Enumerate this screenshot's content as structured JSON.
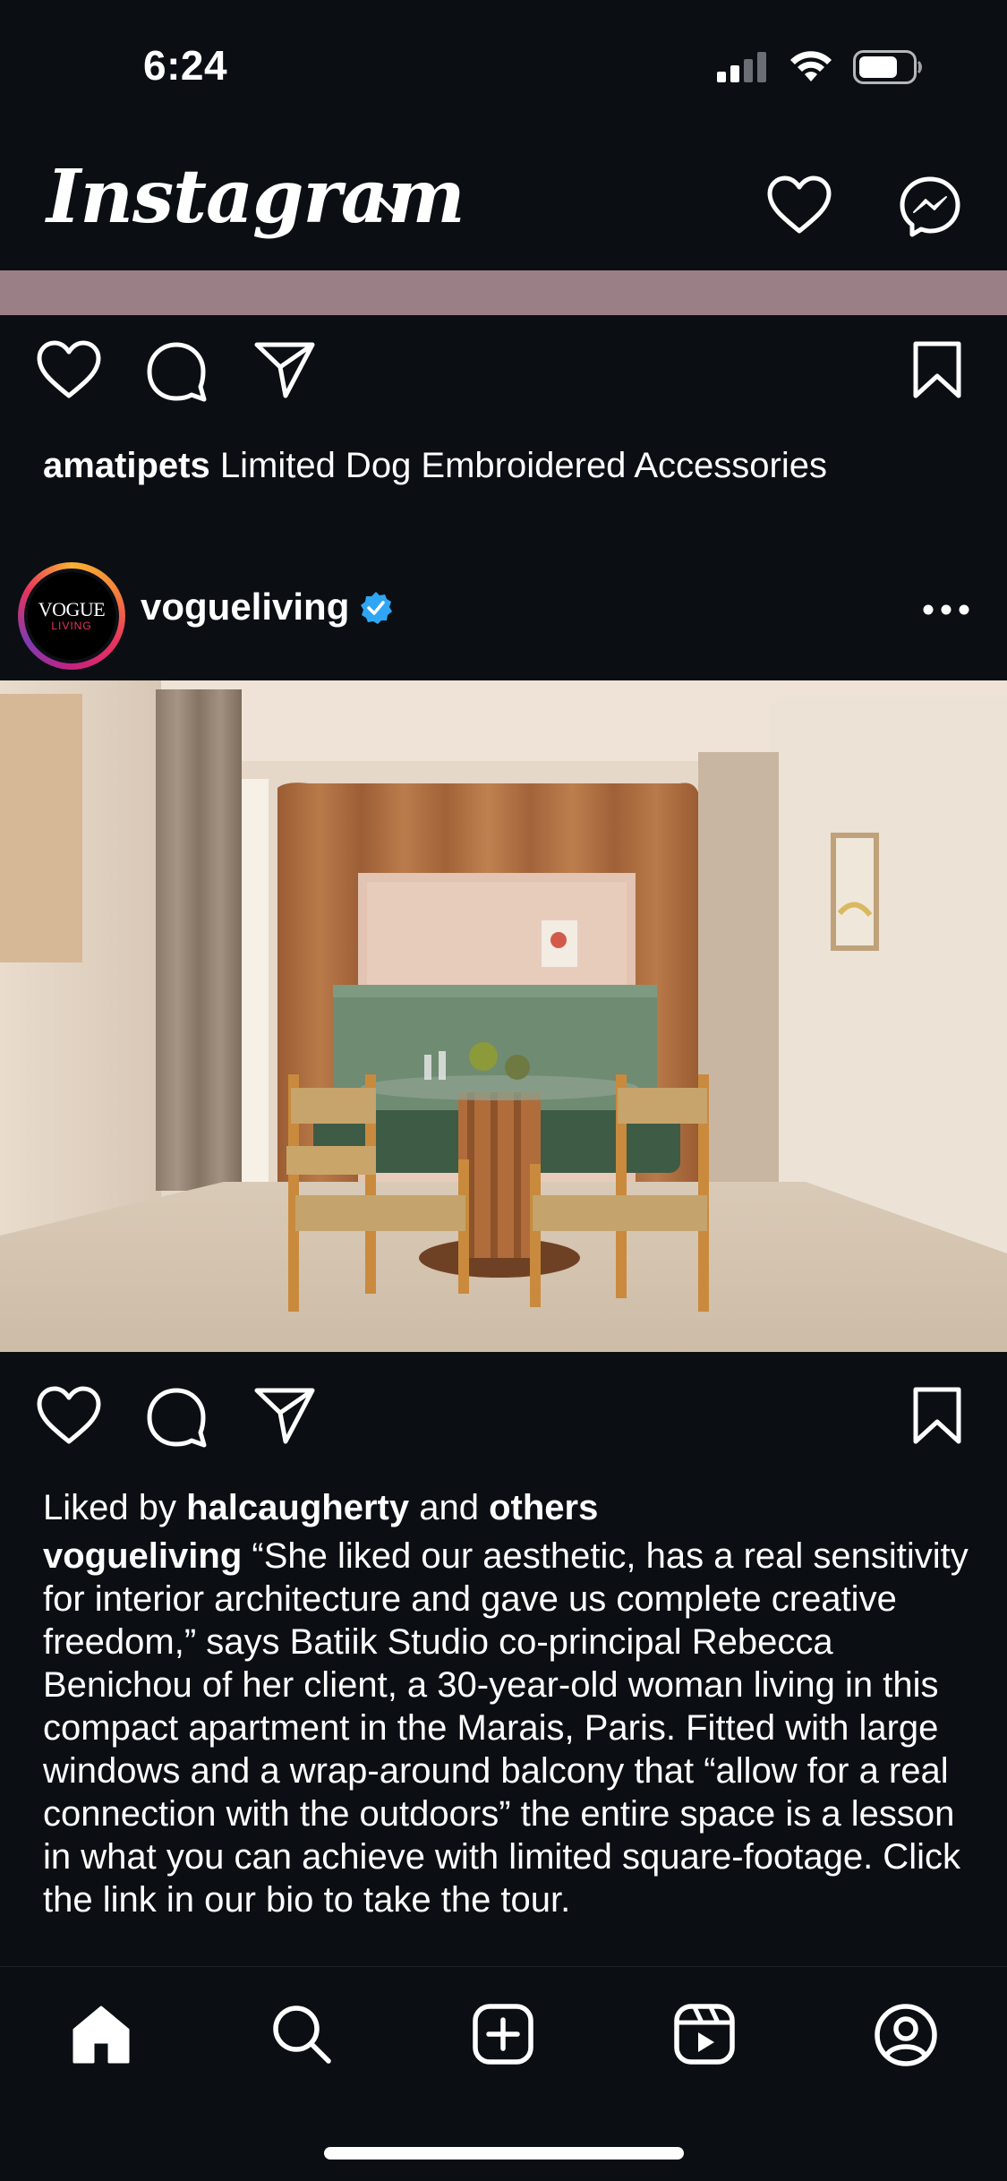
{
  "status_bar": {
    "time": "6:24"
  },
  "header": {
    "app_name": "Instagram"
  },
  "previous_post": {
    "username": "amatipets",
    "caption": "Limited Dog Embroidered Accessories"
  },
  "post": {
    "avatar_text_top": "VOGUE",
    "avatar_text_bottom": "LIVING",
    "username": "vogueliving",
    "liked_prefix": "Liked by",
    "liked_user": "halcaugherty",
    "liked_and": "and",
    "liked_others": "others",
    "caption_username": "vogueliving",
    "caption_text": "“She liked our aesthetic, has a real sensitivity for interior architecture and gave us complete creative freedom,” says Batiik Studio co-principal Rebecca Benichou of her client, a  30-year-old woman living in this compact apartment in the Marais, Paris. Fitted with large windows and a wrap-around balcony that “allow for a real connection with the outdoors” the entire space is a lesson in what you can achieve with limited square-footage. Click the link in our bio to take the tour."
  },
  "icons": {
    "header": [
      "heart-icon",
      "messenger-icon",
      "chevron-down-icon"
    ],
    "actions": [
      "heart-icon",
      "comment-icon",
      "share-icon",
      "bookmark-icon"
    ],
    "nav": [
      "home-icon",
      "search-icon",
      "create-icon",
      "reels-icon",
      "profile-icon"
    ]
  },
  "colors": {
    "background": "#0b0f14",
    "verified": "#2fa6f5",
    "story_ring_start": "#f9b233",
    "story_ring_end": "#c4227f"
  }
}
